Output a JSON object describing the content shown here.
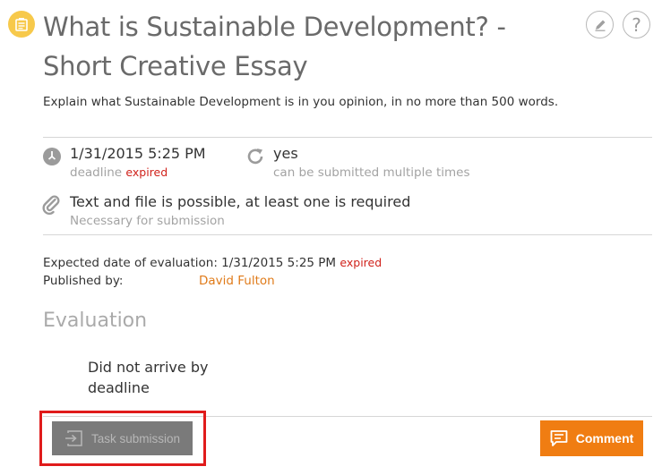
{
  "task": {
    "title": "What is Sustainable Development? - Short Creative Essay",
    "description": "Explain what Sustainable Development is in you opinion, in no more than 500 words."
  },
  "icons": {
    "task": "assignment-icon",
    "edit": "pencil-icon",
    "help": "question-icon",
    "deadline": "clock-icon",
    "resubmit": "refresh-icon",
    "submission_type": "paperclip-icon",
    "task_submission": "submit-arrow-icon",
    "comment": "comment-icon"
  },
  "help_button": {
    "label": "?"
  },
  "deadline": {
    "value": "1/31/2015 5:25 PM",
    "label": "deadline",
    "status": "expired"
  },
  "resubmission": {
    "value": "yes",
    "label": "can be submitted multiple times"
  },
  "submission_type": {
    "value": "Text and file is possible, at least one is required",
    "label": "Necessary for submission"
  },
  "meta": {
    "expected_evaluation_label": "Expected date of evaluation:",
    "expected_evaluation_date": "1/31/2015 5:25 PM",
    "expected_evaluation_status": "expired",
    "published_by_label": "Published by:",
    "published_by": "David Fulton"
  },
  "evaluation": {
    "heading": "Evaluation",
    "result": "Did not arrive by deadline"
  },
  "actions": {
    "task_submission_label": "Task submission",
    "comment_label": "Comment"
  },
  "colors": {
    "accent": "#f07d12",
    "expired": "#d0221b",
    "task_icon_bg": "#f7c94b",
    "disabled_button": "#7a7a7a",
    "highlight": "#e01b1b"
  }
}
